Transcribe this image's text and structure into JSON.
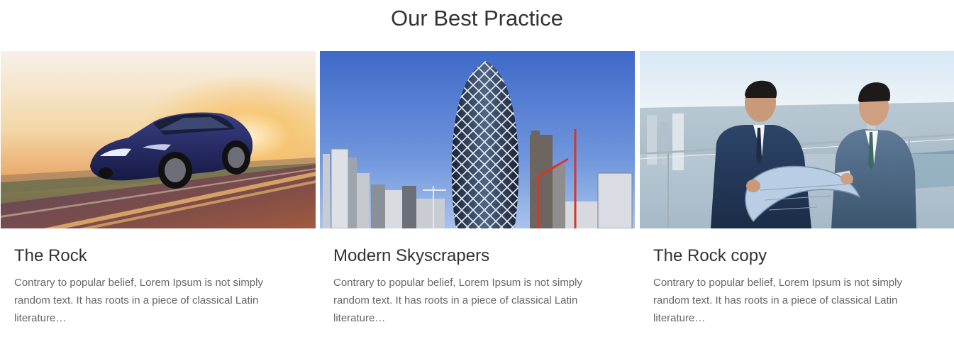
{
  "section": {
    "title": "Our Best Practice"
  },
  "cards": [
    {
      "title": "The Rock",
      "description": "Contrary to popular belief, Lorem Ipsum is not simply random text. It has roots in a piece of classical Latin literature…",
      "image": "sports-car-on-road-at-sunset"
    },
    {
      "title": "Modern Skyscrapers",
      "description": "Contrary to popular belief, Lorem Ipsum is not simply random text. It has roots in a piece of classical Latin literature…",
      "image": "gherkin-skyscraper-cityscape"
    },
    {
      "title": "The Rock copy",
      "description": "Contrary to popular belief, Lorem Ipsum is not simply random text. It has roots in a piece of classical Latin literature…",
      "image": "businessmen-on-balcony-with-blueprint"
    }
  ],
  "colors": {
    "title": "#333333",
    "body_text": "#666666",
    "background": "#ffffff"
  }
}
